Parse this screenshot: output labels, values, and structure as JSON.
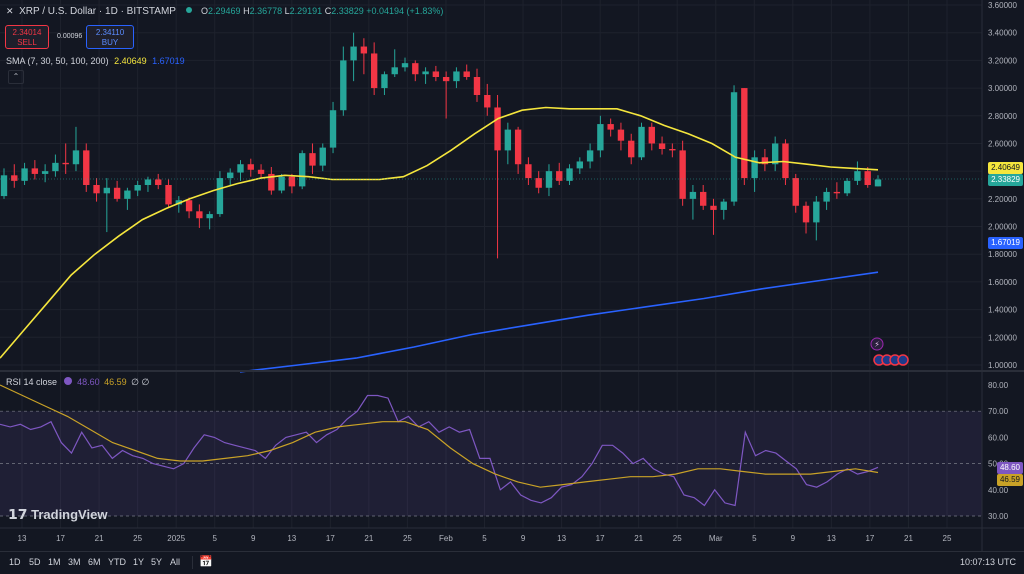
{
  "header": {
    "symbol": "XRP / U.S. Dollar · 1D · BITSTAMP",
    "open_label": "O",
    "open": "2.29469",
    "high_label": "H",
    "high": "2.36778",
    "low_label": "L",
    "low": "2.29191",
    "close_label": "C",
    "close": "2.33829",
    "change": "+0.04194 (+1.83%)"
  },
  "trade": {
    "sell_price": "2.34014",
    "sell_label": "SELL",
    "spread": "0.00096",
    "buy_price": "2.34110",
    "buy_label": "BUY"
  },
  "sma_legend": {
    "label": "SMA (7, 30, 50, 100, 200)",
    "value1": "2.40649",
    "value2": "1.67019"
  },
  "rsi_legend": {
    "label": "RSI 14 close",
    "value1": "48.60",
    "value2": "46.59",
    "extra": "∅ ∅"
  },
  "price_axis": [
    "3.60000",
    "3.40000",
    "3.20000",
    "3.00000",
    "2.80000",
    "2.60000",
    "2.40000",
    "2.20000",
    "2.00000",
    "1.80000",
    "1.60000",
    "1.40000",
    "1.20000",
    "1.00000"
  ],
  "rsi_axis": [
    "80.00",
    "70.00",
    "60.00",
    "50.00",
    "40.00",
    "30.00"
  ],
  "price_tags": {
    "sma_fast": "2.40649",
    "last": "2.33829",
    "sma_slow": "1.67019",
    "rsi": "48.60",
    "rsi_ma": "46.59"
  },
  "time_axis": [
    "13",
    "17",
    "21",
    "25",
    "2025",
    "5",
    "9",
    "13",
    "17",
    "21",
    "25",
    "Feb",
    "5",
    "9",
    "13",
    "17",
    "21",
    "25",
    "Mar",
    "5",
    "9",
    "13",
    "17",
    "21",
    "25"
  ],
  "time_range": [
    "1D",
    "5D",
    "1M",
    "3M",
    "6M",
    "YTD",
    "1Y",
    "5Y",
    "All"
  ],
  "clock": "10:07:13 UTC",
  "logo_text": "TradingView",
  "colors": {
    "background": "#131722",
    "up": "#26a69a",
    "down": "#f23645",
    "sma_fast": "#f5e63d",
    "sma_slow": "#2962ff",
    "rsi": "#7e57c2",
    "rsi_ma": "#c9a227"
  },
  "chart_data": [
    {
      "type": "candlestick",
      "title": "XRP / U.S. Dollar · 1D · BITSTAMP",
      "ylim": [
        0.95,
        3.62
      ],
      "x_range": [
        "Dec 10, 2024",
        "Mar 17, 2025"
      ],
      "candles": [
        {
          "o": 2.22,
          "h": 2.42,
          "l": 2.2,
          "c": 2.37
        },
        {
          "o": 2.37,
          "h": 2.45,
          "l": 2.28,
          "c": 2.33
        },
        {
          "o": 2.33,
          "h": 2.46,
          "l": 2.3,
          "c": 2.42
        },
        {
          "o": 2.42,
          "h": 2.48,
          "l": 2.34,
          "c": 2.38
        },
        {
          "o": 2.38,
          "h": 2.45,
          "l": 2.32,
          "c": 2.4
        },
        {
          "o": 2.4,
          "h": 2.52,
          "l": 2.36,
          "c": 2.46
        },
        {
          "o": 2.46,
          "h": 2.6,
          "l": 2.38,
          "c": 2.45
        },
        {
          "o": 2.45,
          "h": 2.72,
          "l": 2.4,
          "c": 2.55
        },
        {
          "o": 2.55,
          "h": 2.6,
          "l": 2.25,
          "c": 2.3
        },
        {
          "o": 2.3,
          "h": 2.35,
          "l": 2.18,
          "c": 2.24
        },
        {
          "o": 2.24,
          "h": 2.35,
          "l": 1.96,
          "c": 2.28
        },
        {
          "o": 2.28,
          "h": 2.33,
          "l": 2.18,
          "c": 2.2
        },
        {
          "o": 2.2,
          "h": 2.28,
          "l": 2.12,
          "c": 2.26
        },
        {
          "o": 2.26,
          "h": 2.33,
          "l": 2.22,
          "c": 2.3
        },
        {
          "o": 2.3,
          "h": 2.36,
          "l": 2.25,
          "c": 2.34
        },
        {
          "o": 2.34,
          "h": 2.38,
          "l": 2.27,
          "c": 2.3
        },
        {
          "o": 2.3,
          "h": 2.34,
          "l": 2.14,
          "c": 2.16
        },
        {
          "o": 2.16,
          "h": 2.22,
          "l": 2.1,
          "c": 2.19
        },
        {
          "o": 2.19,
          "h": 2.21,
          "l": 2.06,
          "c": 2.11
        },
        {
          "o": 2.11,
          "h": 2.16,
          "l": 1.99,
          "c": 2.06
        },
        {
          "o": 2.06,
          "h": 2.11,
          "l": 1.98,
          "c": 2.09
        },
        {
          "o": 2.09,
          "h": 2.4,
          "l": 2.07,
          "c": 2.35
        },
        {
          "o": 2.35,
          "h": 2.42,
          "l": 2.3,
          "c": 2.39
        },
        {
          "o": 2.39,
          "h": 2.48,
          "l": 2.33,
          "c": 2.45
        },
        {
          "o": 2.45,
          "h": 2.49,
          "l": 2.36,
          "c": 2.41
        },
        {
          "o": 2.41,
          "h": 2.45,
          "l": 2.35,
          "c": 2.38
        },
        {
          "o": 2.38,
          "h": 2.43,
          "l": 2.23,
          "c": 2.26
        },
        {
          "o": 2.26,
          "h": 2.38,
          "l": 2.24,
          "c": 2.36
        },
        {
          "o": 2.36,
          "h": 2.38,
          "l": 2.24,
          "c": 2.29
        },
        {
          "o": 2.29,
          "h": 2.55,
          "l": 2.27,
          "c": 2.53
        },
        {
          "o": 2.53,
          "h": 2.6,
          "l": 2.38,
          "c": 2.44
        },
        {
          "o": 2.44,
          "h": 2.6,
          "l": 2.4,
          "c": 2.57
        },
        {
          "o": 2.57,
          "h": 2.9,
          "l": 2.53,
          "c": 2.84
        },
        {
          "o": 2.84,
          "h": 3.3,
          "l": 2.8,
          "c": 3.2
        },
        {
          "o": 3.2,
          "h": 3.4,
          "l": 3.05,
          "c": 3.3
        },
        {
          "o": 3.3,
          "h": 3.36,
          "l": 3.1,
          "c": 3.25
        },
        {
          "o": 3.25,
          "h": 3.33,
          "l": 2.95,
          "c": 3.0
        },
        {
          "o": 3.0,
          "h": 3.12,
          "l": 2.95,
          "c": 3.1
        },
        {
          "o": 3.1,
          "h": 3.28,
          "l": 3.08,
          "c": 3.15
        },
        {
          "o": 3.15,
          "h": 3.22,
          "l": 3.12,
          "c": 3.18
        },
        {
          "o": 3.18,
          "h": 3.2,
          "l": 3.05,
          "c": 3.1
        },
        {
          "o": 3.1,
          "h": 3.15,
          "l": 3.03,
          "c": 3.12
        },
        {
          "o": 3.12,
          "h": 3.16,
          "l": 3.05,
          "c": 3.08
        },
        {
          "o": 3.08,
          "h": 3.12,
          "l": 2.78,
          "c": 3.05
        },
        {
          "o": 3.05,
          "h": 3.15,
          "l": 3.0,
          "c": 3.12
        },
        {
          "o": 3.12,
          "h": 3.17,
          "l": 3.06,
          "c": 3.08
        },
        {
          "o": 3.08,
          "h": 3.14,
          "l": 2.9,
          "c": 2.95
        },
        {
          "o": 2.95,
          "h": 3.03,
          "l": 2.8,
          "c": 2.86
        },
        {
          "o": 2.86,
          "h": 2.95,
          "l": 1.77,
          "c": 2.55
        },
        {
          "o": 2.55,
          "h": 2.75,
          "l": 2.45,
          "c": 2.7
        },
        {
          "o": 2.7,
          "h": 2.72,
          "l": 2.38,
          "c": 2.45
        },
        {
          "o": 2.45,
          "h": 2.5,
          "l": 2.3,
          "c": 2.35
        },
        {
          "o": 2.35,
          "h": 2.4,
          "l": 2.24,
          "c": 2.28
        },
        {
          "o": 2.28,
          "h": 2.45,
          "l": 2.22,
          "c": 2.4
        },
        {
          "o": 2.4,
          "h": 2.46,
          "l": 2.3,
          "c": 2.33
        },
        {
          "o": 2.33,
          "h": 2.45,
          "l": 2.3,
          "c": 2.42
        },
        {
          "o": 2.42,
          "h": 2.5,
          "l": 2.38,
          "c": 2.47
        },
        {
          "o": 2.47,
          "h": 2.6,
          "l": 2.42,
          "c": 2.55
        },
        {
          "o": 2.55,
          "h": 2.8,
          "l": 2.5,
          "c": 2.74
        },
        {
          "o": 2.74,
          "h": 2.78,
          "l": 2.65,
          "c": 2.7
        },
        {
          "o": 2.7,
          "h": 2.75,
          "l": 2.55,
          "c": 2.62
        },
        {
          "o": 2.62,
          "h": 2.67,
          "l": 2.45,
          "c": 2.5
        },
        {
          "o": 2.5,
          "h": 2.75,
          "l": 2.48,
          "c": 2.72
        },
        {
          "o": 2.72,
          "h": 2.75,
          "l": 2.55,
          "c": 2.6
        },
        {
          "o": 2.6,
          "h": 2.65,
          "l": 2.52,
          "c": 2.56
        },
        {
          "o": 2.56,
          "h": 2.6,
          "l": 2.5,
          "c": 2.55
        },
        {
          "o": 2.55,
          "h": 2.62,
          "l": 2.15,
          "c": 2.2
        },
        {
          "o": 2.2,
          "h": 2.3,
          "l": 2.05,
          "c": 2.25
        },
        {
          "o": 2.25,
          "h": 2.3,
          "l": 2.12,
          "c": 2.15
        },
        {
          "o": 2.15,
          "h": 2.2,
          "l": 1.94,
          "c": 2.12
        },
        {
          "o": 2.12,
          "h": 2.2,
          "l": 2.05,
          "c": 2.18
        },
        {
          "o": 2.18,
          "h": 3.02,
          "l": 2.15,
          "c": 2.97
        },
        {
          "o": 3.0,
          "h": 3.0,
          "l": 2.3,
          "c": 2.35
        },
        {
          "o": 2.35,
          "h": 2.55,
          "l": 2.25,
          "c": 2.5
        },
        {
          "o": 2.5,
          "h": 2.56,
          "l": 2.4,
          "c": 2.45
        },
        {
          "o": 2.45,
          "h": 2.65,
          "l": 2.4,
          "c": 2.6
        },
        {
          "o": 2.6,
          "h": 2.63,
          "l": 2.3,
          "c": 2.35
        },
        {
          "o": 2.35,
          "h": 2.38,
          "l": 2.1,
          "c": 2.15
        },
        {
          "o": 2.15,
          "h": 2.18,
          "l": 1.95,
          "c": 2.03
        },
        {
          "o": 2.03,
          "h": 2.22,
          "l": 1.9,
          "c": 2.18
        },
        {
          "o": 2.18,
          "h": 2.28,
          "l": 2.12,
          "c": 2.25
        },
        {
          "o": 2.25,
          "h": 2.32,
          "l": 2.2,
          "c": 2.24
        },
        {
          "o": 2.24,
          "h": 2.35,
          "l": 2.22,
          "c": 2.33
        },
        {
          "o": 2.33,
          "h": 2.47,
          "l": 2.3,
          "c": 2.4
        },
        {
          "o": 2.4,
          "h": 2.43,
          "l": 2.28,
          "c": 2.3
        },
        {
          "o": 2.29,
          "h": 2.37,
          "l": 2.29,
          "c": 2.34
        }
      ],
      "series": [
        {
          "name": "SMA (7, 30, 50, 100, 200)",
          "values": [
            1.05,
            1.25,
            1.45,
            1.65,
            1.8,
            1.93,
            2.05,
            2.13,
            2.2,
            2.26,
            2.31,
            2.35,
            2.37,
            2.36,
            2.34,
            2.34,
            2.34,
            2.36,
            2.44,
            2.55,
            2.67,
            2.78,
            2.84,
            2.86,
            2.85,
            2.85,
            2.85,
            2.8,
            2.73,
            2.67,
            2.6,
            2.5,
            2.46,
            2.47,
            2.45,
            2.43,
            2.42,
            2.41
          ]
        },
        {
          "name": "SMA (7, 30, 50, 100, 200)",
          "values": [
            0.95,
            1.0,
            1.05,
            1.13,
            1.22,
            1.29,
            1.36,
            1.42,
            1.48,
            1.55,
            1.61,
            1.67
          ]
        }
      ]
    },
    {
      "type": "line",
      "title": "RSI 14 close",
      "ylim": [
        27,
        83
      ],
      "series": [
        {
          "name": "RSI 14 close",
          "values": [
            65,
            64,
            65,
            63,
            64,
            66,
            58,
            54,
            62,
            56,
            57,
            52,
            55,
            53,
            52,
            50,
            49,
            48,
            50,
            56,
            61,
            60,
            58,
            57,
            56,
            55,
            52,
            57,
            60,
            61,
            62,
            58,
            61,
            63,
            67,
            70,
            76,
            76,
            75,
            66,
            68,
            64,
            66,
            62,
            64,
            62,
            63,
            52,
            52,
            40,
            43,
            38,
            36,
            35,
            37,
            41,
            42,
            45,
            50,
            57,
            57,
            54,
            50,
            52,
            48,
            46,
            45,
            38,
            37,
            34,
            40,
            35,
            34,
            62,
            53,
            55,
            54,
            51,
            48,
            42,
            41,
            43,
            46,
            48,
            46,
            47,
            48.6
          ]
        },
        {
          "name": "RSI MA",
          "values": [
            80,
            76,
            72,
            68,
            63,
            58,
            55,
            52,
            51,
            51,
            52,
            53,
            55,
            58,
            62,
            64,
            65,
            66,
            66,
            63,
            56,
            50,
            46,
            43,
            41,
            42,
            43,
            44,
            45,
            45,
            46,
            48,
            48,
            47,
            46,
            46,
            46,
            47,
            48,
            46.59
          ]
        }
      ]
    }
  ]
}
